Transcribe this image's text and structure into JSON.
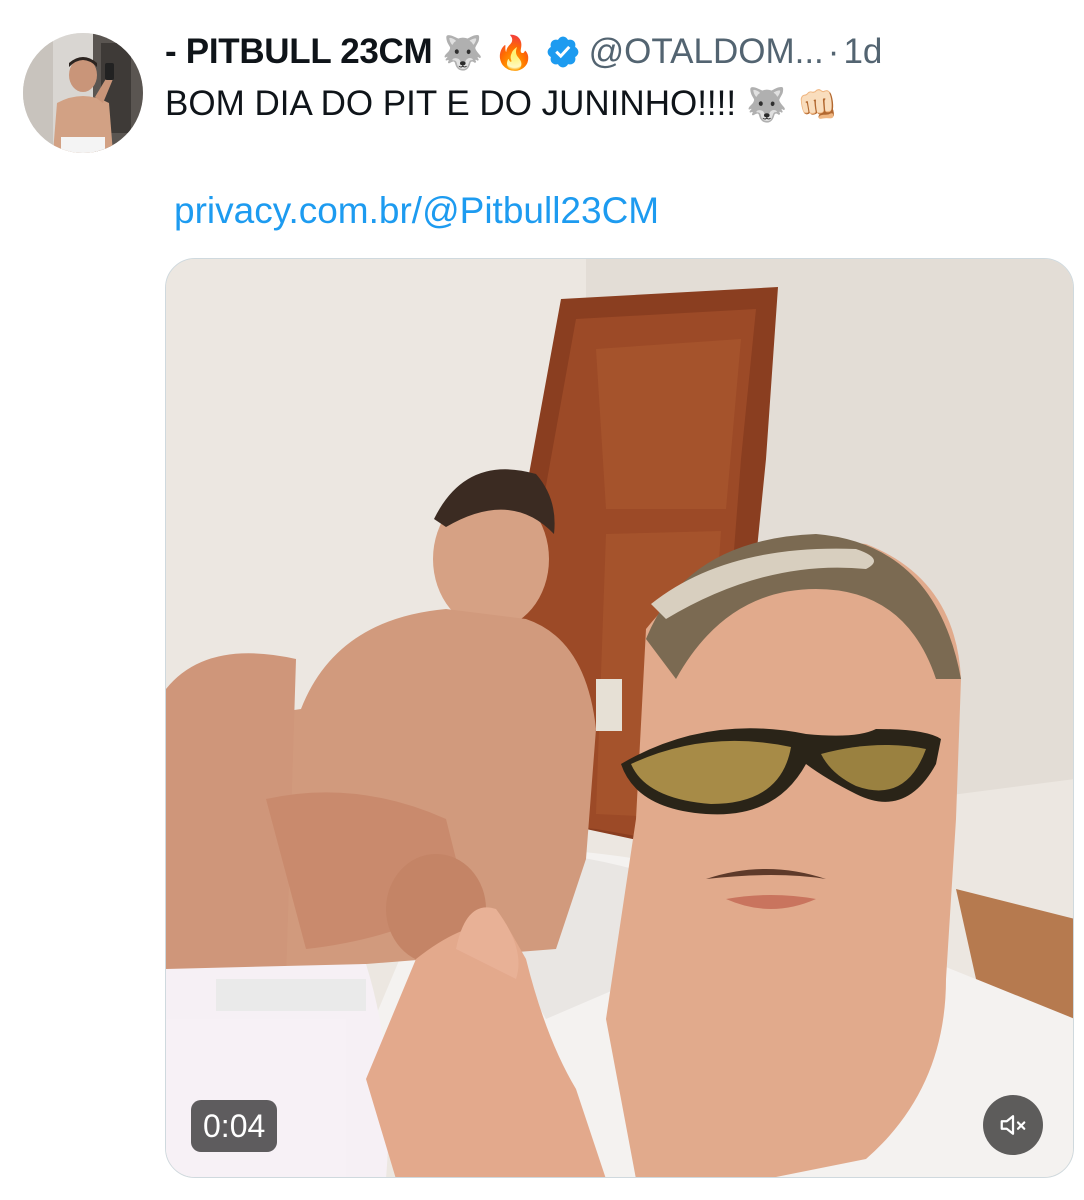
{
  "tweet": {
    "display_name": "- PITBULL 23CM",
    "name_emojis": [
      "🐺",
      "🔥"
    ],
    "handle": "@OTALDOM...",
    "separator": "·",
    "timestamp": "1d",
    "text": "BOM DIA DO PIT E DO JUNINHO!!!!",
    "text_emojis": [
      "🐺",
      "👊🏻"
    ],
    "link": "privacy.com.br/@Pitbull23CM"
  },
  "media": {
    "type": "video",
    "duration": "0:04",
    "muted": true
  },
  "colors": {
    "text": "#0f1419",
    "secondary": "#536471",
    "link": "#1d9bf0",
    "verified": "#1d9bf0"
  },
  "icons": {
    "verified": "verified-badge-icon",
    "mute": "speaker-muted-icon"
  }
}
